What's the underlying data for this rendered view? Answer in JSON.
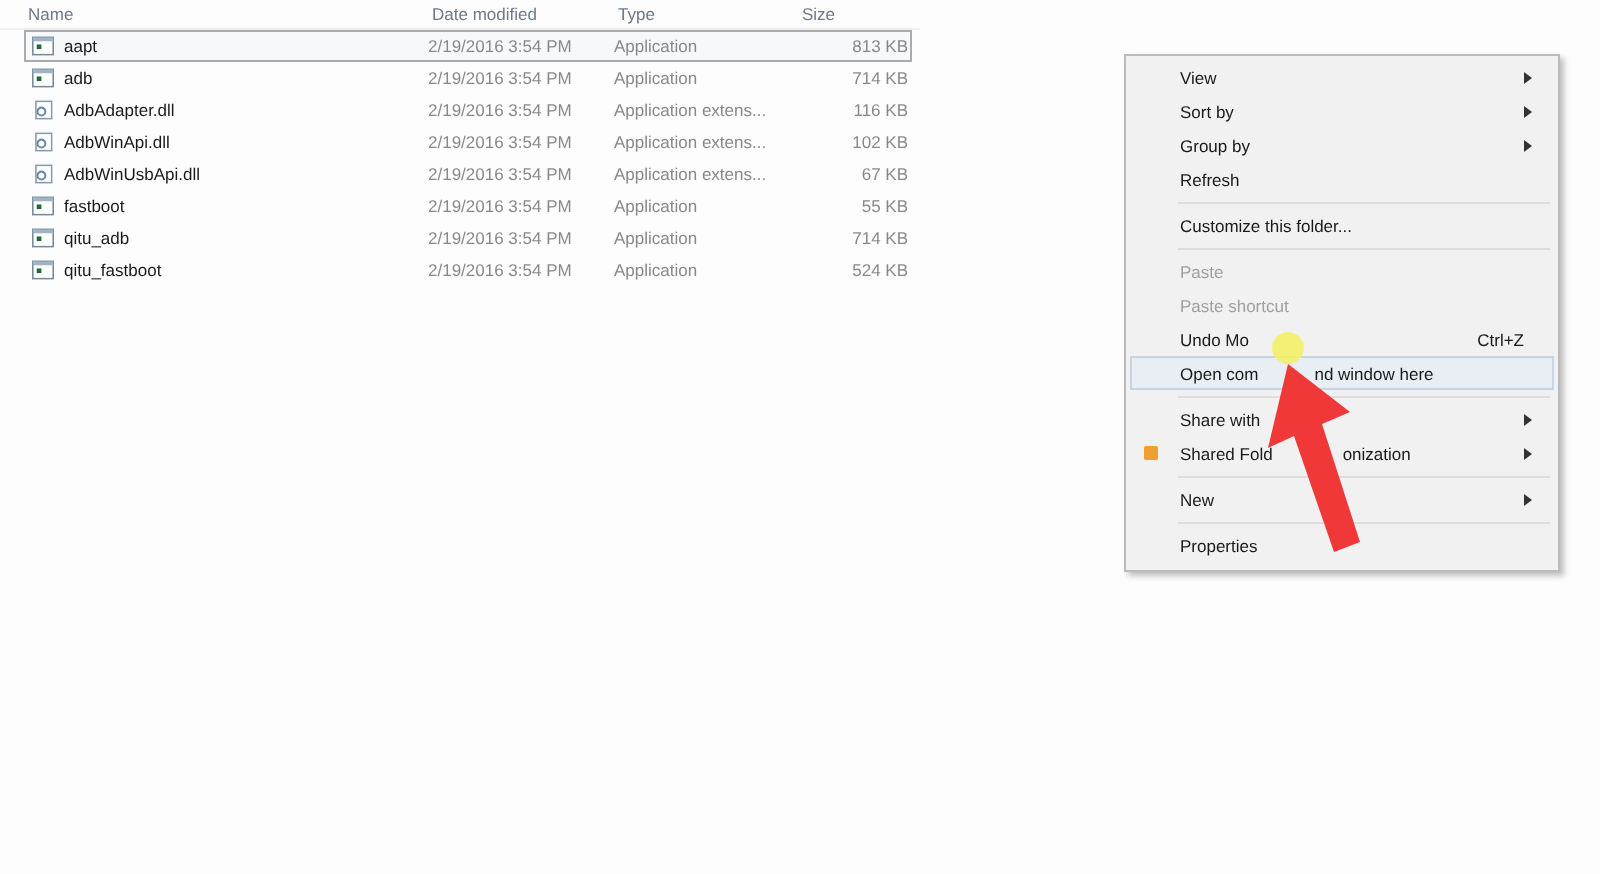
{
  "file_list": {
    "columns": [
      "Name",
      "Date modified",
      "Type",
      "Size"
    ],
    "rows": [
      {
        "name": "aapt",
        "kind": "exe",
        "date": "2/19/2016 3:54 PM",
        "type": "Application",
        "size": "813 KB",
        "selected": true
      },
      {
        "name": "adb",
        "kind": "exe",
        "date": "2/19/2016 3:54 PM",
        "type": "Application",
        "size": "714 KB",
        "selected": false
      },
      {
        "name": "AdbAdapter.dll",
        "kind": "dll",
        "date": "2/19/2016 3:54 PM",
        "type": "Application extens...",
        "size": "116 KB",
        "selected": false
      },
      {
        "name": "AdbWinApi.dll",
        "kind": "dll",
        "date": "2/19/2016 3:54 PM",
        "type": "Application extens...",
        "size": "102 KB",
        "selected": false
      },
      {
        "name": "AdbWinUsbApi.dll",
        "kind": "dll",
        "date": "2/19/2016 3:54 PM",
        "type": "Application extens...",
        "size": "67 KB",
        "selected": false
      },
      {
        "name": "fastboot",
        "kind": "exe",
        "date": "2/19/2016 3:54 PM",
        "type": "Application",
        "size": "55 KB",
        "selected": false
      },
      {
        "name": "qitu_adb",
        "kind": "exe",
        "date": "2/19/2016 3:54 PM",
        "type": "Application",
        "size": "714 KB",
        "selected": false
      },
      {
        "name": "qitu_fastboot",
        "kind": "exe",
        "date": "2/19/2016 3:54 PM",
        "type": "Application",
        "size": "524 KB",
        "selected": false
      }
    ]
  },
  "context_menu": {
    "groups": [
      [
        {
          "label": "View",
          "submenu": true
        },
        {
          "label": "Sort by",
          "submenu": true
        },
        {
          "label": "Group by",
          "submenu": true
        },
        {
          "label": "Refresh"
        }
      ],
      [
        {
          "label": "Customize this folder..."
        }
      ],
      [
        {
          "label": "Paste",
          "disabled": true
        },
        {
          "label": "Paste shortcut",
          "disabled": true
        },
        {
          "label": [
            "Undo Mo"
          ],
          "shortcut": "Ctrl+Z"
        },
        {
          "label": [
            "Open com",
            "nd window here"
          ],
          "hovered": true
        }
      ],
      [
        {
          "label": "Share with",
          "submenu": true
        },
        {
          "label": [
            "Shared Fold",
            "onization"
          ],
          "submenu": true,
          "icon": true
        }
      ],
      [
        {
          "label": "New",
          "submenu": true
        }
      ],
      [
        {
          "label": "Properties"
        }
      ]
    ]
  }
}
